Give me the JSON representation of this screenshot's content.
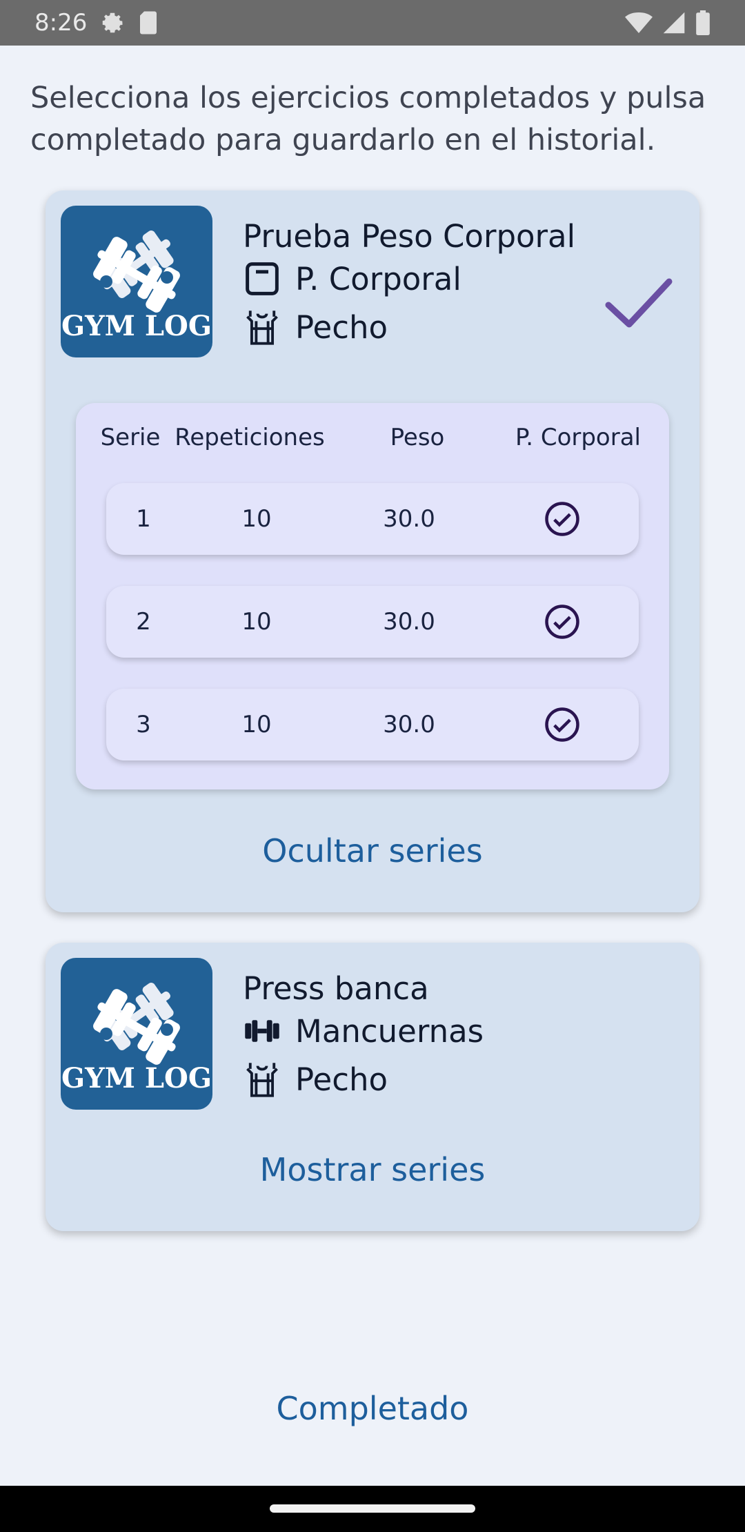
{
  "status_bar": {
    "time": "8:26",
    "icons": [
      "settings-gear-icon",
      "sim-card-icon",
      "wifi-icon",
      "signal-icon",
      "battery-icon"
    ]
  },
  "intro_text": "Selecciona los ejercicios completados y pulsa completado para guardarlo en el historial.",
  "logo_text": "GYM LOG",
  "exercises": [
    {
      "title": "Prueba Peso Corporal",
      "equipment": "P. Corporal",
      "equipment_icon": "scale-icon",
      "muscle": "Pecho",
      "muscle_icon": "chest-icon",
      "selected": true,
      "toggle_label": "Ocultar series",
      "series_headers": {
        "serie": "Serie",
        "reps": "Repeticiones",
        "peso": "Peso",
        "corporal": "P. Corporal"
      },
      "series": [
        {
          "serie": "1",
          "reps": "10",
          "peso": "30.0",
          "corporal": true
        },
        {
          "serie": "2",
          "reps": "10",
          "peso": "30.0",
          "corporal": true
        },
        {
          "serie": "3",
          "reps": "10",
          "peso": "30.0",
          "corporal": true
        }
      ]
    },
    {
      "title": "Press banca",
      "equipment": "Mancuernas",
      "equipment_icon": "dumbbell-icon",
      "muscle": "Pecho",
      "muscle_icon": "chest-icon",
      "selected": false,
      "toggle_label": "Mostrar series"
    }
  ],
  "complete_button": "Completado",
  "colors": {
    "background": "#eef2f9",
    "card": "#d5e1f0",
    "series_panel": "#dfe0fa",
    "logo_bg": "#226196",
    "link": "#1d5e9c",
    "check": "#6a4fa3"
  }
}
